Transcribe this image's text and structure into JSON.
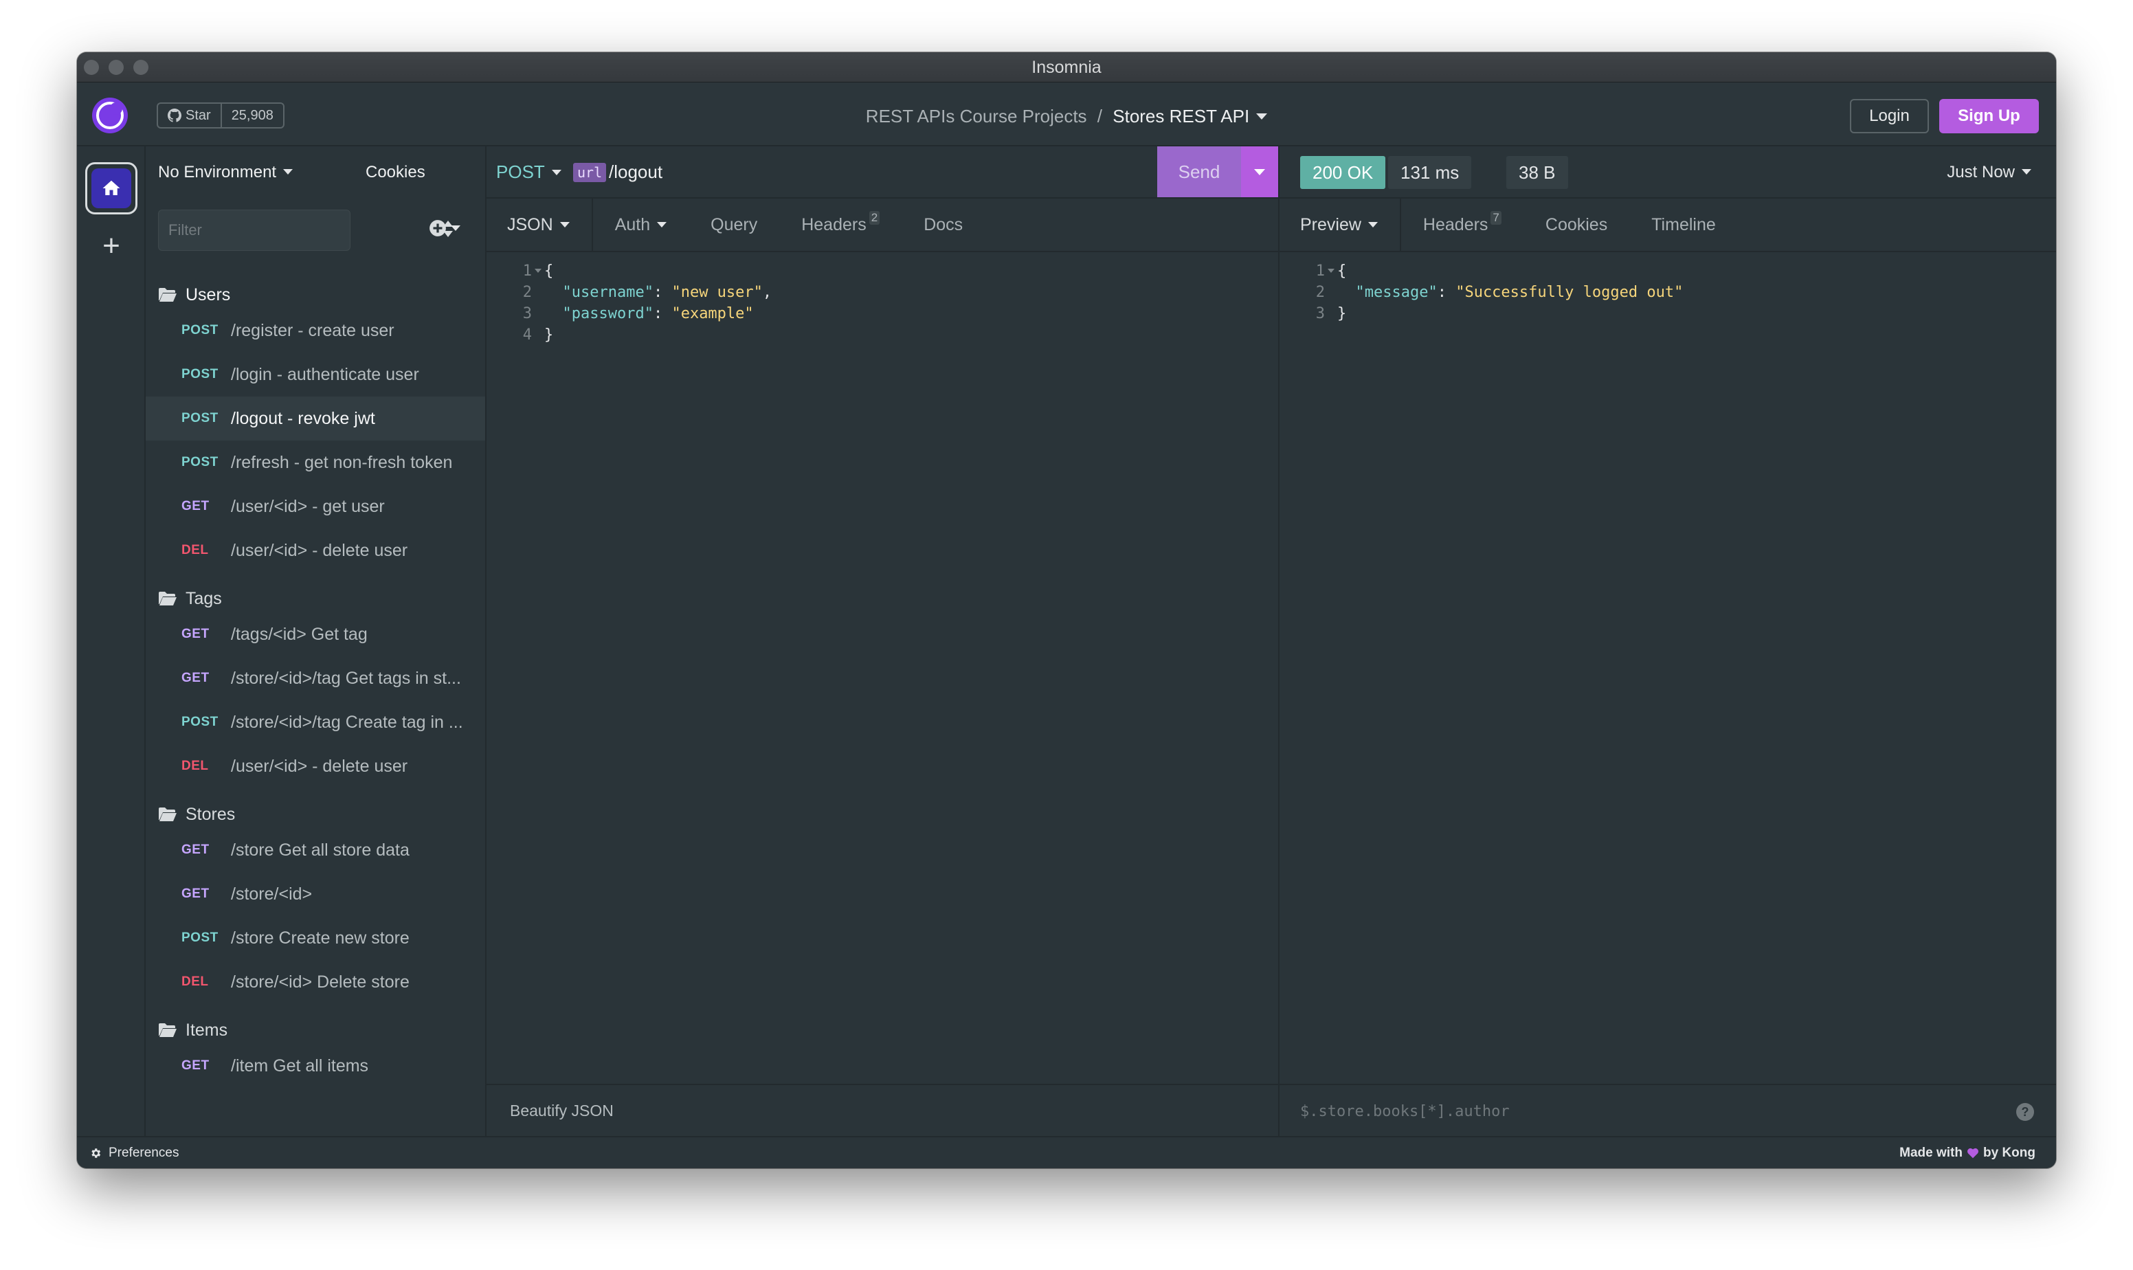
{
  "window": {
    "title": "Insomnia"
  },
  "header": {
    "github_star_label": "Star",
    "github_star_count": "25,908",
    "breadcrumb_project": "REST APIs Course Projects",
    "breadcrumb_separator": "/",
    "breadcrumb_current": "Stores REST API",
    "login_label": "Login",
    "signup_label": "Sign Up"
  },
  "sidebar": {
    "environment": "No Environment",
    "cookies_label": "Cookies",
    "filter_placeholder": "Filter",
    "folders": [
      {
        "name": "Users",
        "requests": [
          {
            "method": "POST",
            "name": "/register - create user"
          },
          {
            "method": "POST",
            "name": "/login - authenticate user"
          },
          {
            "method": "POST",
            "name": "/logout - revoke jwt",
            "selected": true
          },
          {
            "method": "POST",
            "name": "/refresh - get non-fresh token"
          },
          {
            "method": "GET",
            "name": "/user/<id> - get user"
          },
          {
            "method": "DEL",
            "name": "/user/<id> - delete user"
          }
        ]
      },
      {
        "name": "Tags",
        "requests": [
          {
            "method": "GET",
            "name": "/tags/<id> Get tag"
          },
          {
            "method": "GET",
            "name": "/store/<id>/tag Get tags in st..."
          },
          {
            "method": "POST",
            "name": "/store/<id>/tag Create tag in ..."
          },
          {
            "method": "DEL",
            "name": "/user/<id> - delete user"
          }
        ]
      },
      {
        "name": "Stores",
        "requests": [
          {
            "method": "GET",
            "name": "/store Get all store data"
          },
          {
            "method": "GET",
            "name": "/store/<id>"
          },
          {
            "method": "POST",
            "name": "/store Create new store"
          },
          {
            "method": "DEL",
            "name": "/store/<id> Delete store"
          }
        ]
      },
      {
        "name": "Items",
        "requests": [
          {
            "method": "GET",
            "name": "/item Get all items"
          }
        ]
      }
    ]
  },
  "request": {
    "method": "POST",
    "url_tag": "url",
    "url_path": "/logout",
    "send_label": "Send",
    "tabs": [
      {
        "label": "JSON",
        "dropdown": true
      },
      {
        "label": "Auth",
        "dropdown": true
      },
      {
        "label": "Query"
      },
      {
        "label": "Headers",
        "badge": "2"
      },
      {
        "label": "Docs"
      }
    ],
    "body_lines": [
      {
        "n": "1",
        "parts": [
          {
            "t": "{",
            "c": ""
          }
        ]
      },
      {
        "n": "2",
        "parts": [
          {
            "t": "  \"username\"",
            "c": "k"
          },
          {
            "t": ": ",
            "c": ""
          },
          {
            "t": "\"new user\"",
            "c": "s"
          },
          {
            "t": ",",
            "c": ""
          }
        ]
      },
      {
        "n": "3",
        "parts": [
          {
            "t": "  \"password\"",
            "c": "k"
          },
          {
            "t": ": ",
            "c": ""
          },
          {
            "t": "\"example\"",
            "c": "s"
          }
        ]
      },
      {
        "n": "4",
        "parts": [
          {
            "t": "}",
            "c": ""
          }
        ]
      }
    ],
    "footer_label": "Beautify JSON"
  },
  "response": {
    "status": "200 OK",
    "time": "131 ms",
    "size": "38 B",
    "timestamp": "Just Now",
    "tabs": [
      {
        "label": "Preview",
        "dropdown": true
      },
      {
        "label": "Headers",
        "badge": "7"
      },
      {
        "label": "Cookies"
      },
      {
        "label": "Timeline"
      }
    ],
    "body_lines": [
      {
        "n": "1",
        "parts": [
          {
            "t": "{",
            "c": ""
          }
        ]
      },
      {
        "n": "2",
        "parts": [
          {
            "t": "  \"message\"",
            "c": "k"
          },
          {
            "t": ": ",
            "c": ""
          },
          {
            "t": "\"Successfully logged out\"",
            "c": "s"
          }
        ]
      },
      {
        "n": "3",
        "parts": [
          {
            "t": "}",
            "c": ""
          }
        ]
      }
    ],
    "filter_placeholder": "$.store.books[*].author"
  },
  "statusbar": {
    "preferences_label": "Preferences",
    "made_with_prefix": "Made with",
    "made_with_suffix": "by Kong"
  },
  "colors": {
    "accent": "#b45ce0",
    "post": "#7ed3d0",
    "get": "#c6a6ff",
    "del": "#f2566e",
    "status_ok": "#5fb0a4"
  }
}
